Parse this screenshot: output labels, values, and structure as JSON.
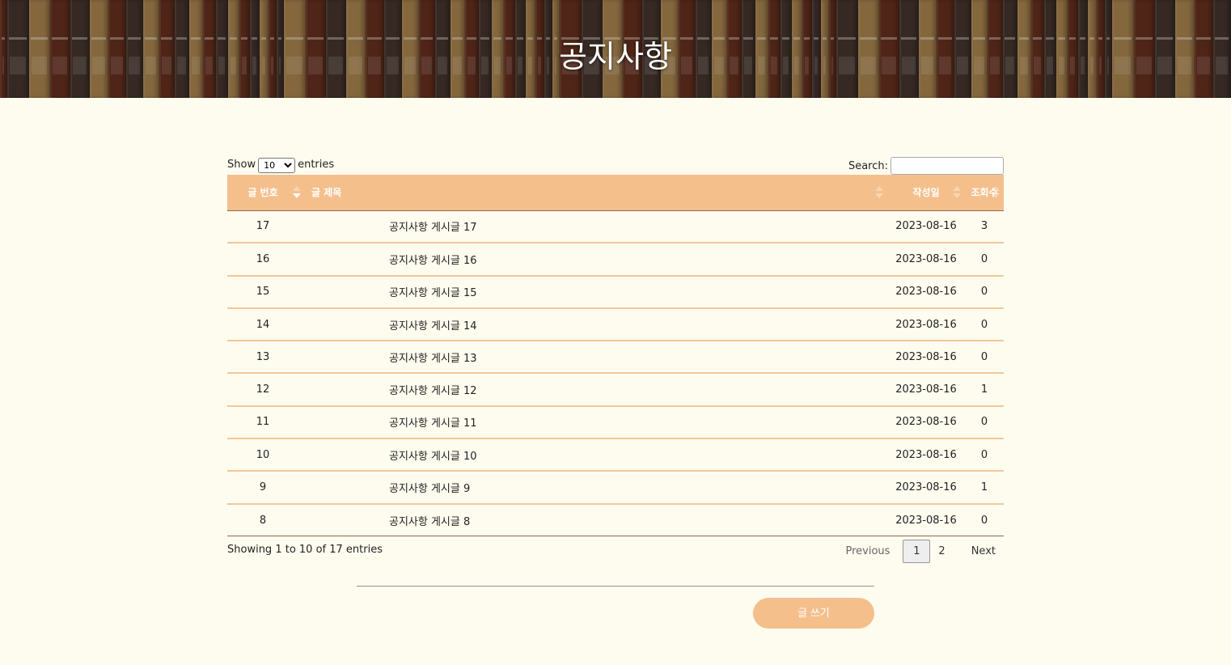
{
  "banner": {
    "title": "공지사항"
  },
  "controls": {
    "show_label": "Show",
    "entries_label": "entries",
    "page_length": "10",
    "search_label": "Search:",
    "search_value": ""
  },
  "table": {
    "headers": [
      "글 번호",
      "글 제목",
      "작성일",
      "조회수"
    ],
    "sort_column": "글 번호",
    "sort_direction": "desc",
    "rows": [
      {
        "no": "17",
        "title": "공지사항 게시글 17",
        "date": "2023-08-16",
        "views": "3"
      },
      {
        "no": "16",
        "title": "공지사항 게시글 16",
        "date": "2023-08-16",
        "views": "0"
      },
      {
        "no": "15",
        "title": "공지사항 게시글 15",
        "date": "2023-08-16",
        "views": "0"
      },
      {
        "no": "14",
        "title": "공지사항 게시글 14",
        "date": "2023-08-16",
        "views": "0"
      },
      {
        "no": "13",
        "title": "공지사항 게시글 13",
        "date": "2023-08-16",
        "views": "0"
      },
      {
        "no": "12",
        "title": "공지사항 게시글 12",
        "date": "2023-08-16",
        "views": "1"
      },
      {
        "no": "11",
        "title": "공지사항 게시글 11",
        "date": "2023-08-16",
        "views": "0"
      },
      {
        "no": "10",
        "title": "공지사항 게시글 10",
        "date": "2023-08-16",
        "views": "0"
      },
      {
        "no": "9",
        "title": "공지사항 게시글 9",
        "date": "2023-08-16",
        "views": "1"
      },
      {
        "no": "8",
        "title": "공지사항 게시글 8",
        "date": "2023-08-16",
        "views": "0"
      }
    ]
  },
  "footer": {
    "info": "Showing 1 to 10 of 17 entries",
    "previous": "Previous",
    "pages": [
      "1",
      "2"
    ],
    "current_page": "1",
    "next": "Next",
    "write_button": "글 쓰기"
  },
  "colors": {
    "accent": "#f5bf8c",
    "background": "#fefcef",
    "row_border": "#f3c69a"
  }
}
